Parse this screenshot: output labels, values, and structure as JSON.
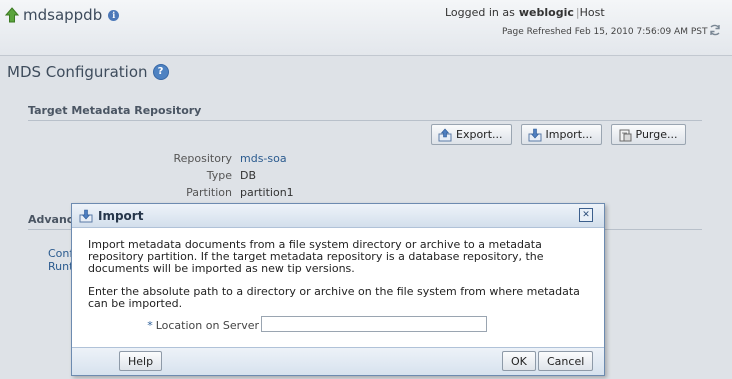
{
  "header": {
    "app_name": "mdsappdb",
    "logged_in_label": "Logged in as",
    "user": "weblogic",
    "separator": "|",
    "host": "Host",
    "page_refreshed": "Page Refreshed Feb 15, 2010 7:56:09 AM PST"
  },
  "page": {
    "title": "MDS Configuration"
  },
  "target_section": {
    "heading": "Target Metadata Repository",
    "buttons": {
      "export": "Export...",
      "import": "Import...",
      "purge": "Purge..."
    },
    "repository_label": "Repository",
    "repository_value": "mds-soa",
    "type_label": "Type",
    "type_value": "DB",
    "partition_label": "Partition",
    "partition_value": "partition1"
  },
  "advanced_section": {
    "heading": "Advanc",
    "link1": "Confi",
    "link2": "Runti"
  },
  "dialog": {
    "title": "Import",
    "close": "✕",
    "description": "Import metadata documents from a file system directory or archive to a metadata repository partition. If the target metadata repository is a database repository, the documents will be imported as new tip versions.",
    "instruction": "Enter the absolute path to a directory or archive on the file system from where metadata can be imported.",
    "required_mark": "*",
    "location_label": "Location on Server",
    "location_value": "",
    "help_button": "Help",
    "ok_button": "OK",
    "cancel_button": "Cancel"
  },
  "colors": {
    "link": "#2b5b8f",
    "dialog_border": "#6d8bb0",
    "background": "#dee2e7"
  }
}
